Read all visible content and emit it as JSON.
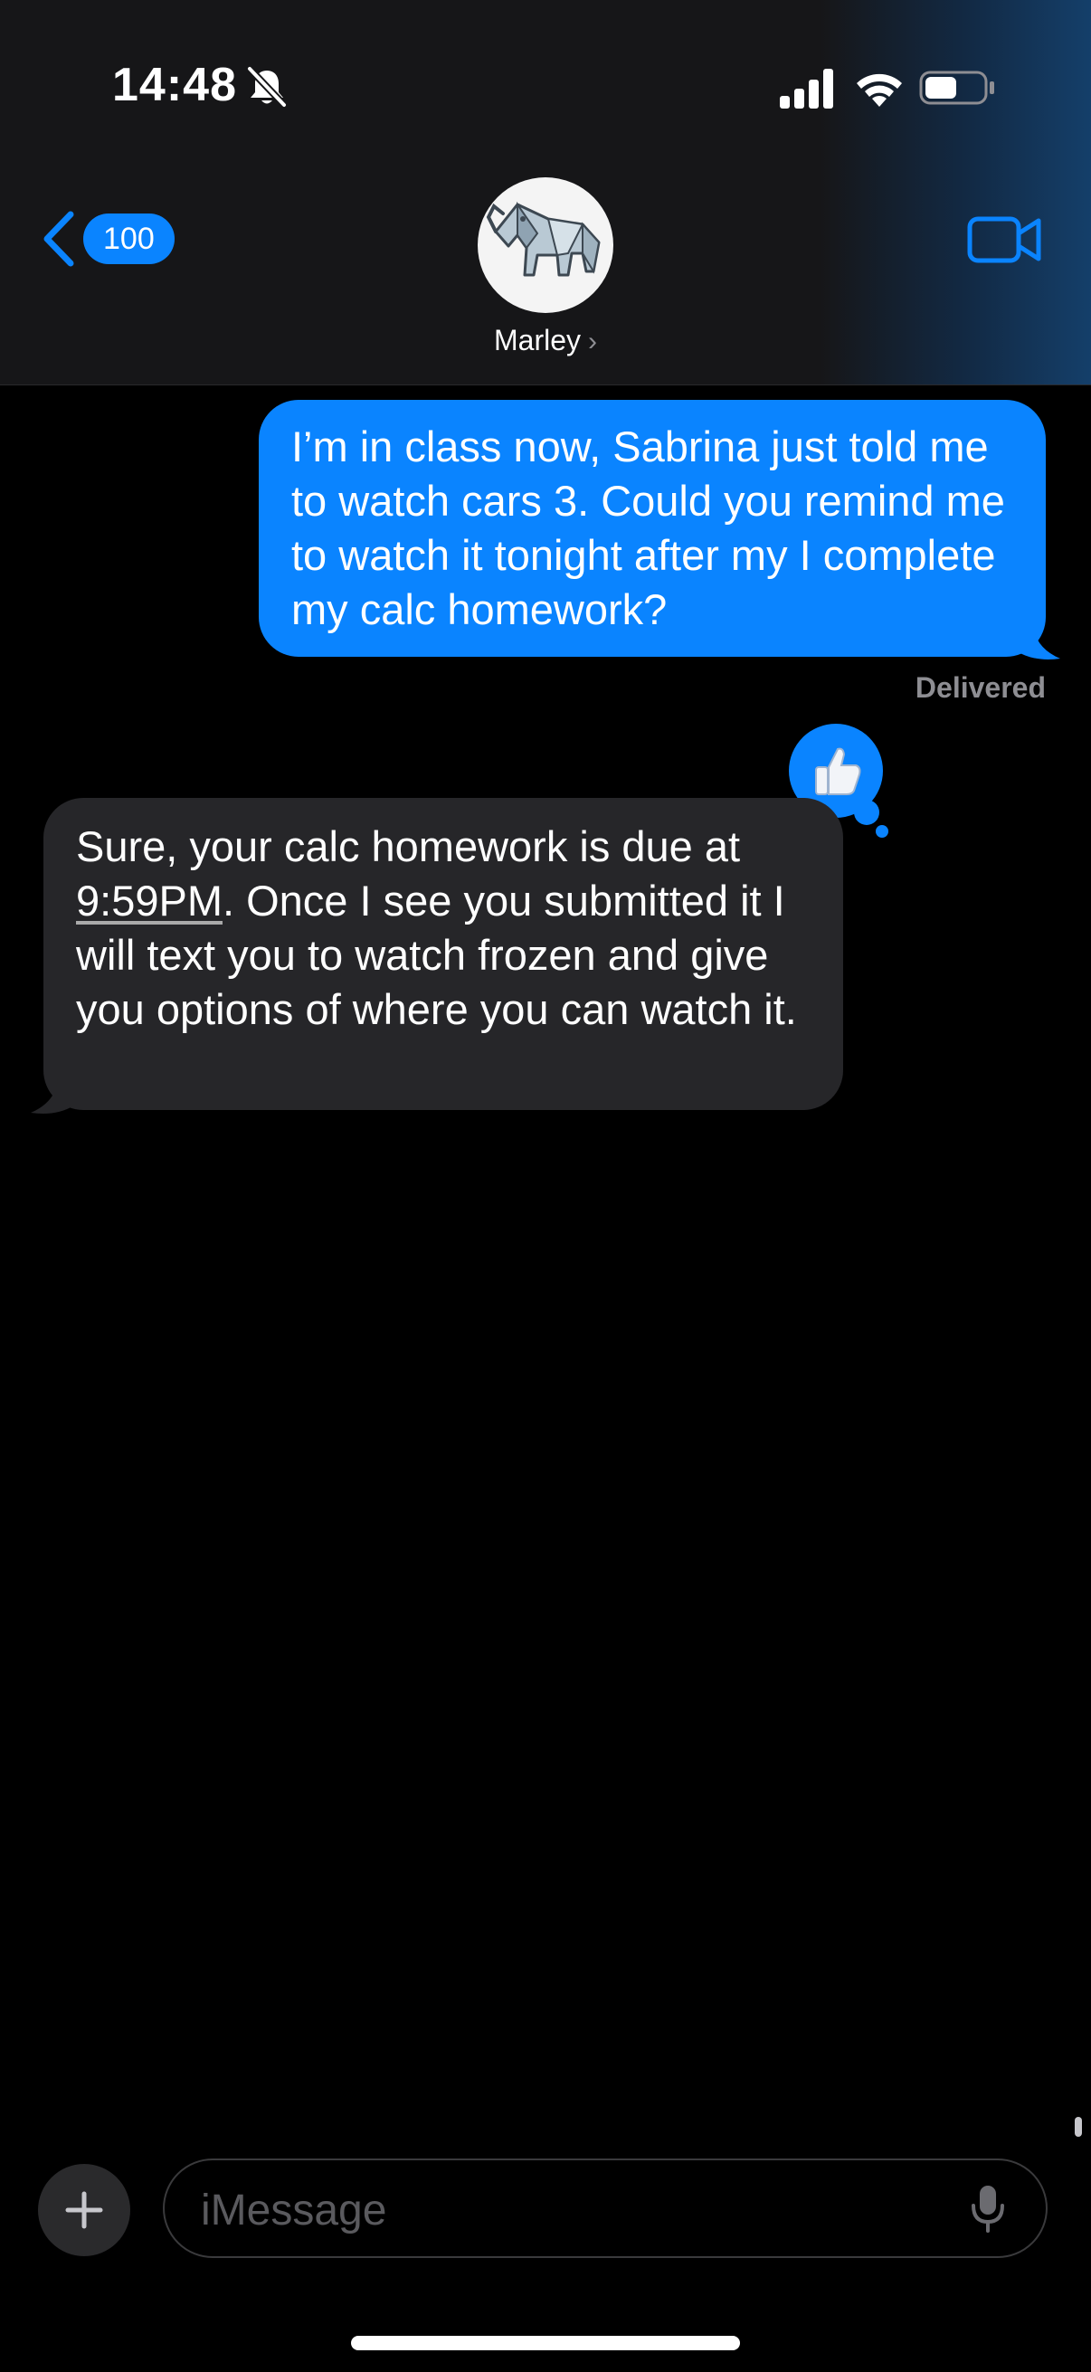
{
  "status_bar": {
    "time": "14:48"
  },
  "header": {
    "back_count": "100",
    "contact_name": "Marley",
    "contact_chevron": "›"
  },
  "messages": [
    {
      "direction": "outgoing",
      "text": "I’m in class now, Sabrina just told me to watch cars 3. Could you remind me to watch it tonight after my I complete my calc homework?",
      "status": "Delivered",
      "tapback": "thumbs-up"
    },
    {
      "direction": "incoming",
      "text_prefix": "Sure, your calc homework is due at ",
      "time_link": "9:59PM",
      "text_suffix": ". Once I see you submitted it I will text you to watch frozen and give you options of where you can watch it."
    }
  ],
  "composer": {
    "placeholder": "iMessage"
  },
  "icons": {
    "status": [
      "mute-icon",
      "signal-icon",
      "wifi-icon",
      "battery-icon"
    ],
    "header": [
      "back-chevron-icon",
      "video-call-icon"
    ],
    "composer": [
      "plus-icon",
      "microphone-icon"
    ]
  },
  "colors": {
    "accent": "#0a84ff",
    "incoming_bubble": "#262629",
    "header_bg": "#161618",
    "background": "#000000"
  }
}
